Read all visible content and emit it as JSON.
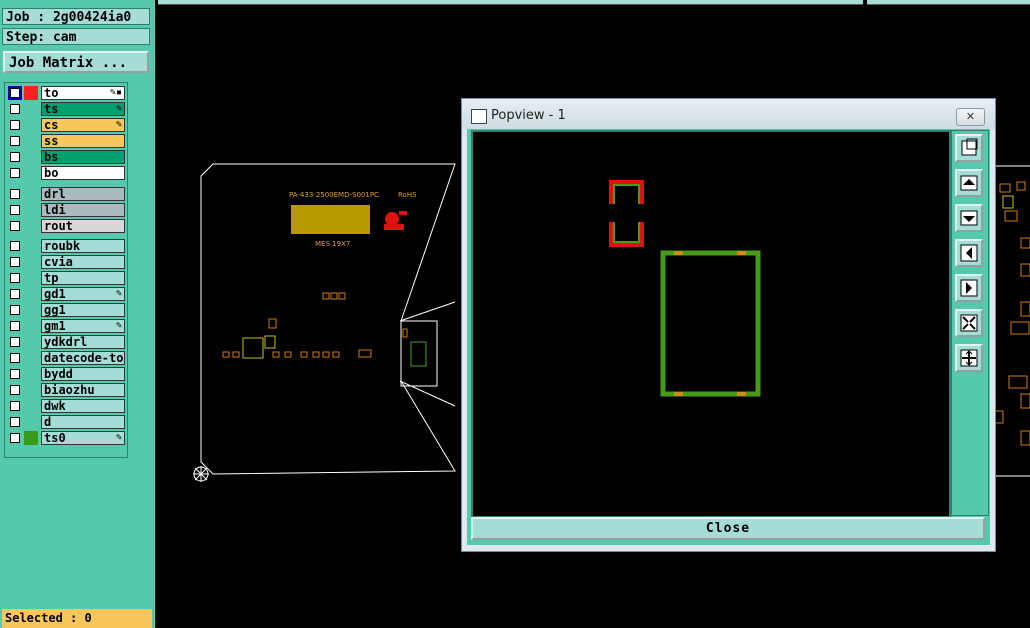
{
  "header": {
    "job": "Job : 2g00424ia0",
    "step": "Step: cam",
    "job_matrix": "Job Matrix ..."
  },
  "layers_group1": [
    {
      "name": "to",
      "color": "#ff2020",
      "bg": "#ffffff",
      "mark": "✎▪",
      "checked": true
    },
    {
      "name": "ts",
      "color": "#55c9ab",
      "bg": "#00a070",
      "mark": "✎",
      "checked": false
    },
    {
      "name": "cs",
      "color": "#55c9ab",
      "bg": "#f7c75c",
      "mark": "✎",
      "checked": false
    },
    {
      "name": "ss",
      "color": "#55c9ab",
      "bg": "#f7c75c",
      "mark": "",
      "checked": false
    },
    {
      "name": "bs",
      "color": "#55c9ab",
      "bg": "#00a070",
      "mark": "",
      "checked": false
    },
    {
      "name": "bo",
      "color": "#55c9ab",
      "bg": "#ffffff",
      "mark": "",
      "checked": false
    }
  ],
  "layers_group2": [
    {
      "name": "drl",
      "bg": "#aabbbf"
    },
    {
      "name": "ldi",
      "bg": "#aabbbf"
    },
    {
      "name": "rout",
      "bg": "#d8d8d8"
    }
  ],
  "layers_group3": [
    {
      "name": "roubk",
      "mark": ""
    },
    {
      "name": "cvia",
      "mark": ""
    },
    {
      "name": "tp",
      "mark": ""
    },
    {
      "name": "gd1",
      "mark": "✎"
    },
    {
      "name": "gg1",
      "mark": ""
    },
    {
      "name": "gm1",
      "mark": "✎"
    },
    {
      "name": "ydkdrl",
      "mark": ""
    },
    {
      "name": "datecode-to",
      "mark": ""
    },
    {
      "name": "bydd",
      "mark": ""
    },
    {
      "name": "biaozhu",
      "mark": ""
    },
    {
      "name": "dwk",
      "mark": ""
    },
    {
      "name": "d",
      "mark": ""
    },
    {
      "name": "ts0",
      "mark": "✎",
      "color": "#3a9a1a"
    }
  ],
  "status": {
    "selected": "Selected : 0"
  },
  "canvas": {
    "board_text1": "PA-433-2500EMD-S001PC",
    "board_text2": "RoHS",
    "board_text3": "MES 19X7"
  },
  "popup": {
    "title": "Popview - 1",
    "close_label": "Close",
    "tools": [
      "zoom-fit-icon",
      "pan-up-icon",
      "pan-down-icon",
      "pan-left-icon",
      "pan-right-icon",
      "zoom-in-icon",
      "zoom-out-icon"
    ]
  },
  "colors": {
    "panel": "#55c9ab",
    "field": "#a5dcd5",
    "green_pad": "#4a9a1a",
    "red_pad": "#e01010",
    "orange": "#d07a10"
  }
}
